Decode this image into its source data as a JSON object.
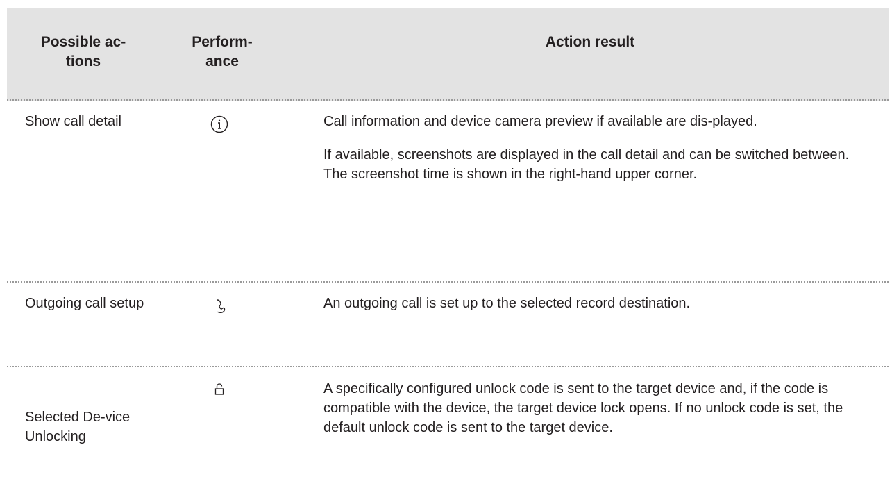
{
  "table": {
    "headers": {
      "actions": [
        "Possible ac-",
        "tions"
      ],
      "performance": [
        "Perform-",
        "ance"
      ],
      "result": "Action result"
    },
    "rows": [
      {
        "action": "Show call detail",
        "icon": "info-circle-icon",
        "result": [
          "Call information and device camera preview if available are dis-played.",
          "If available, screenshots are displayed in the call detail and can be switched between. The screenshot time is shown in the right-hand upper corner."
        ]
      },
      {
        "action": "Outgoing call setup",
        "icon": "phone-handset-icon",
        "result": [
          "An outgoing call is set up to the selected record destination."
        ]
      },
      {
        "action": "Selected De-vice Unlocking",
        "icon": "padlock-icon",
        "result": [
          "A specifically configured unlock code is sent to the target device and, if the code is compatible with the device, the target device lock opens. If no unlock code is set, the default unlock code is sent to the target device."
        ]
      }
    ]
  }
}
